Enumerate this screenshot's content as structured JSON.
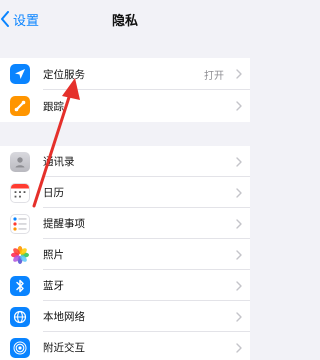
{
  "nav": {
    "back_label": "设置",
    "title": "隐私"
  },
  "group1": [
    {
      "label": "定位服务",
      "value": "打开",
      "icon": "location-arrow-icon",
      "color": "#0a84ff"
    },
    {
      "label": "跟踪",
      "value": "",
      "icon": "tracking-icon",
      "color": "#ff9500"
    }
  ],
  "group2": [
    {
      "label": "通讯录",
      "icon": "contacts-icon",
      "color": "#c7c7cc"
    },
    {
      "label": "日历",
      "icon": "calendar-icon",
      "color": "#ffffff"
    },
    {
      "label": "提醒事项",
      "icon": "reminders-icon",
      "color": "#ffffff"
    },
    {
      "label": "照片",
      "icon": "photos-icon",
      "color": "#ffffff"
    },
    {
      "label": "蓝牙",
      "icon": "bluetooth-icon",
      "color": "#0a84ff"
    },
    {
      "label": "本地网络",
      "icon": "local-network-icon",
      "color": "#0a84ff"
    },
    {
      "label": "附近交互",
      "icon": "nearby-interaction-icon",
      "color": "#0a84ff"
    }
  ],
  "annotation": {
    "color": "#e5302b"
  }
}
